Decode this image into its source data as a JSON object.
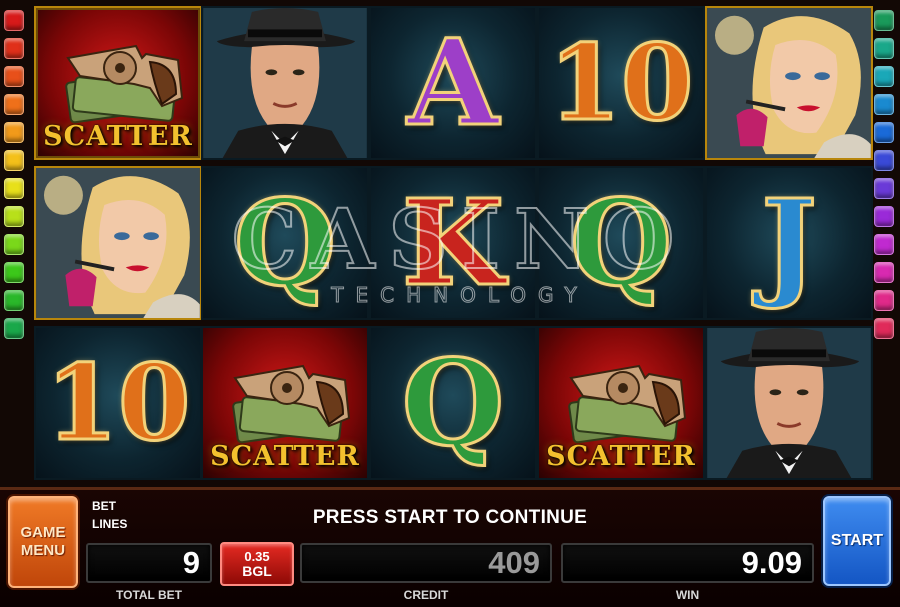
{
  "reels": [
    [
      {
        "type": "scatter",
        "label": "SCATTER",
        "highlight": true
      },
      {
        "type": "character",
        "name": "lady",
        "highlight": true
      },
      {
        "type": "number",
        "label": "10",
        "fill": "#e0701a"
      }
    ],
    [
      {
        "type": "character",
        "name": "gangster",
        "highlight": false
      },
      {
        "type": "letter",
        "label": "Q",
        "fill": "#2e9a3c"
      },
      {
        "type": "scatter",
        "label": "SCATTER",
        "highlight": false
      }
    ],
    [
      {
        "type": "letter",
        "label": "A",
        "fill": "#9d3fc8"
      },
      {
        "type": "letter",
        "label": "K",
        "fill": "#c8241e"
      },
      {
        "type": "letter",
        "label": "Q",
        "fill": "#2e9a3c"
      }
    ],
    [
      {
        "type": "number",
        "label": "10",
        "fill": "#e0701a"
      },
      {
        "type": "letter",
        "label": "Q",
        "fill": "#2e9a3c"
      },
      {
        "type": "scatter",
        "label": "SCATTER",
        "highlight": false
      }
    ],
    [
      {
        "type": "character",
        "name": "lady",
        "highlight": true
      },
      {
        "type": "letter",
        "label": "J",
        "fill": "#2a8ad0"
      },
      {
        "type": "character",
        "name": "gangster",
        "highlight": false
      }
    ]
  ],
  "line_indicator_colors": [
    "#d81a1a",
    "#e0301a",
    "#e8501a",
    "#ef701a",
    "#f29a1a",
    "#f4c01a",
    "#e8e01a",
    "#b8e01a",
    "#7ad81a",
    "#3cc81a",
    "#2ab82a",
    "#1aa84a"
  ],
  "line_indicator_colors_right": [
    "#1a9a5a",
    "#1aa88a",
    "#1aa8b8",
    "#1a8ad0",
    "#1a6ad8",
    "#3a4ad8",
    "#6a3ad8",
    "#9a2ad8",
    "#c02ad0",
    "#d82ab0",
    "#e02a8a",
    "#e02a5a"
  ],
  "panel": {
    "game_menu_label": "GAME MENU",
    "bet_label": "BET",
    "lines_label": "LINES",
    "message": "PRESS START TO CONTINUE",
    "total_bet_value": "9",
    "total_bet_label": "TOTAL BET",
    "denomination_value": "0.35",
    "denomination_currency": "BGL",
    "credit_value": "409",
    "credit_label": "CREDIT",
    "win_value": "9.09",
    "win_label": "WIN",
    "start_label": "START"
  },
  "watermark": {
    "line1": "CASINO",
    "line2": "TECHNOLOGY"
  },
  "colors": {
    "total_bet_text": "#ffffff",
    "credit_text": "#9a9a9a",
    "win_text": "#ffffff"
  }
}
